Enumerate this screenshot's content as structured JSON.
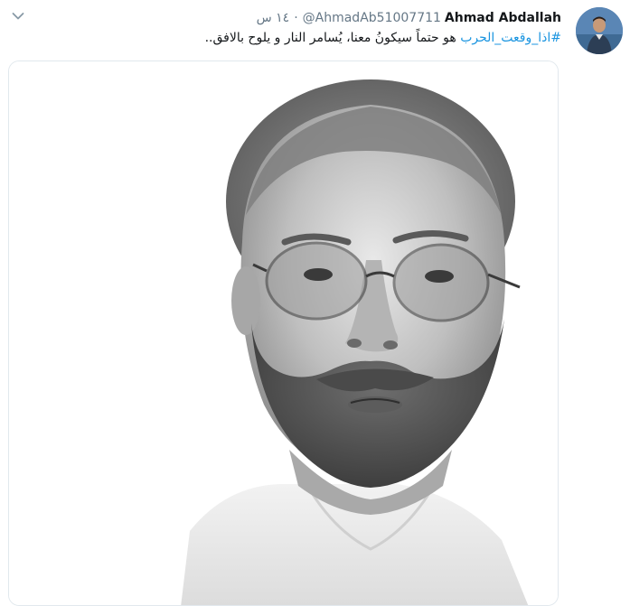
{
  "tweet": {
    "author_name": "Ahmad Abdallah",
    "author_handle": "@AhmadAb51007711",
    "separator": "·",
    "timestamp": "١٤ س",
    "hashtag": "#اذا_وقعت_الحرب",
    "body": "هو حتماً سيكونُ معنا، يُسامر النار و يلوح بالافق.."
  },
  "icons": {
    "menu": "chevron-down-icon"
  },
  "colors": {
    "hashtag": "#1b95e0",
    "meta": "#657786",
    "border": "#e1e8ed"
  }
}
